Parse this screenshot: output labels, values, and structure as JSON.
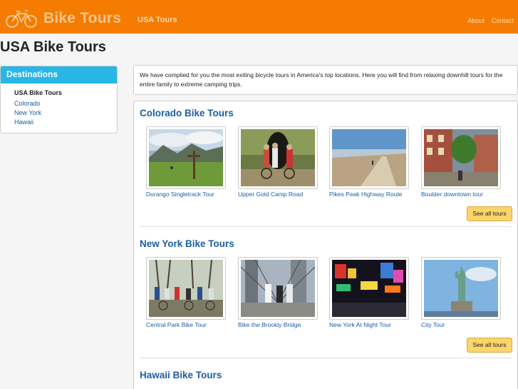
{
  "brand": {
    "name": "Bike Tours",
    "icon": "bicycle-icon"
  },
  "nav": {
    "main": "USA Tours",
    "about": "About",
    "contact": "Contact"
  },
  "page_title": "USA Bike Tours",
  "sidebar": {
    "heading": "Destinations",
    "items": [
      {
        "label": "USA Bike Tours",
        "active": true
      },
      {
        "label": "Colorado",
        "active": false
      },
      {
        "label": "New York",
        "active": false
      },
      {
        "label": "Hawaii",
        "active": false
      }
    ]
  },
  "intro": "We have complied for you the most exiting bicycle tours in America's top locations. Here you will find from relaxing downhill tours for the entire family to extreme camping trips.",
  "sections": [
    {
      "title": "Colorado Bike Tours",
      "tours": [
        "Durango Singletrack Tour",
        "Upper Gold Camp Road",
        "Pikes Peak Highway Route",
        "Boulder downtown tour"
      ],
      "button": "See all tours"
    },
    {
      "title": "New York Bike Tours",
      "tours": [
        "Central Park Bike Tour",
        "Bike the Brookly Bridge",
        "New York At Night Tour",
        "City Tour"
      ],
      "button": "See all tours"
    },
    {
      "title": "Hawaii Bike Tours",
      "tours": [],
      "button": ""
    }
  ],
  "colors": {
    "navbar": "#f57c00",
    "sidebar_header": "#29b6e6",
    "link": "#1a5fa5",
    "button": "#fbd56b"
  }
}
